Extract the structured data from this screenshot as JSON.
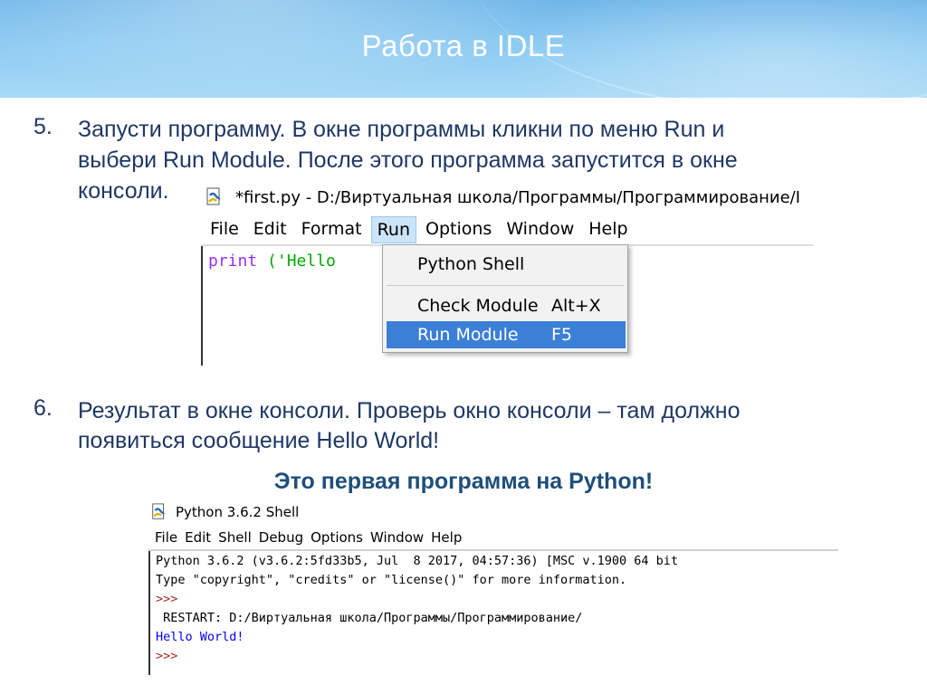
{
  "slide": {
    "title": "Работа в IDLE",
    "caption": "Это первая программа на Python!"
  },
  "steps": [
    {
      "number": "5.",
      "lines": [
        "Запусти программу. В окне программы кликни по меню Run и",
        "выбери Run Module. После этого программа запустится в окне",
        "консоли."
      ]
    },
    {
      "number": "6.",
      "lines": [
        "Результат в окне консоли. Проверь окно консоли – там должно",
        "появиться сообщение Hello World!"
      ]
    }
  ],
  "editor": {
    "title": "*first.py - D:/Виртуальная школа/Программы/Программирование/I",
    "menu": [
      "File",
      "Edit",
      "Format",
      "Run",
      "Options",
      "Window",
      "Help"
    ],
    "active_menu": "Run",
    "code_keyword": "print",
    "code_rest": " ('Hello",
    "dropdown": {
      "python_shell": "Python Shell",
      "check_module": "Check Module",
      "check_module_shortcut": "Alt+X",
      "run_module": "Run Module",
      "run_module_shortcut": "F5"
    }
  },
  "shell": {
    "title": "Python 3.6.2 Shell",
    "menu": [
      "File",
      "Edit",
      "Shell",
      "Debug",
      "Options",
      "Window",
      "Help"
    ],
    "lines": [
      "Python 3.6.2 (v3.6.2:5fd33b5, Jul  8 2017, 04:57:36) [MSC v.1900 64 bit",
      "Type \"copyright\", \"credits\" or \"license()\" for more information.",
      ">>>",
      " RESTART: D:/Виртуальная школа/Программы/Программирование/",
      "Hello World!",
      ">>>"
    ]
  },
  "colors": {
    "text_dark_blue": "#1f3864",
    "caption_blue": "#1f4e79",
    "keyword_purple": "#9b30ff",
    "string_green": "#00aa00",
    "prompt_maroon": "#a52a2a",
    "output_blue": "#0000ff",
    "menu_highlight": "#3b7fd7"
  }
}
